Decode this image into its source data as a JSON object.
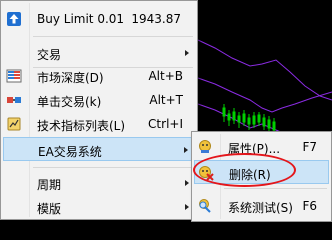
{
  "main_menu": {
    "buy_limit": {
      "label": "Buy Limit 0.01",
      "price": "1943.87",
      "icon": "upload-arrow-icon"
    },
    "items": [
      {
        "label": "交易",
        "shortcut": "",
        "submenu": true,
        "icon": ""
      },
      {
        "label": "市场深度(D)",
        "shortcut": "Alt+B",
        "submenu": false,
        "icon": "market-depth-icon"
      },
      {
        "label": "单击交易(k)",
        "shortcut": "Alt+T",
        "submenu": false,
        "icon": "one-click-trading-icon"
      },
      {
        "label": "技术指标列表(L)",
        "shortcut": "Ctrl+I",
        "submenu": false,
        "icon": "indicator-list-icon"
      },
      {
        "label": "EA交易系统",
        "shortcut": "",
        "submenu": true,
        "icon": "",
        "highlighted": true
      },
      {
        "label": "周期",
        "shortcut": "",
        "submenu": true,
        "icon": ""
      },
      {
        "label": "模版",
        "shortcut": "",
        "submenu": true,
        "icon": ""
      }
    ]
  },
  "sub_menu": {
    "items": [
      {
        "label": "属性(P)...",
        "shortcut": "F7",
        "icon": "ea-properties-icon"
      },
      {
        "label": "删除(R)",
        "shortcut": "",
        "icon": "ea-remove-icon",
        "highlighted": true,
        "annotated": true
      },
      {
        "label": "系统测试(S)",
        "shortcut": "F6",
        "icon": "strategy-tester-icon"
      }
    ]
  },
  "colors": {
    "menu_bg": "#f2f2f2",
    "highlight_bg": "#cce4f7",
    "highlight_border": "#99c9ef",
    "annotation_red": "#e4161b",
    "chart_bg": "#000000",
    "chart_band": "#8a2be2",
    "candle_green": "#00d000"
  }
}
